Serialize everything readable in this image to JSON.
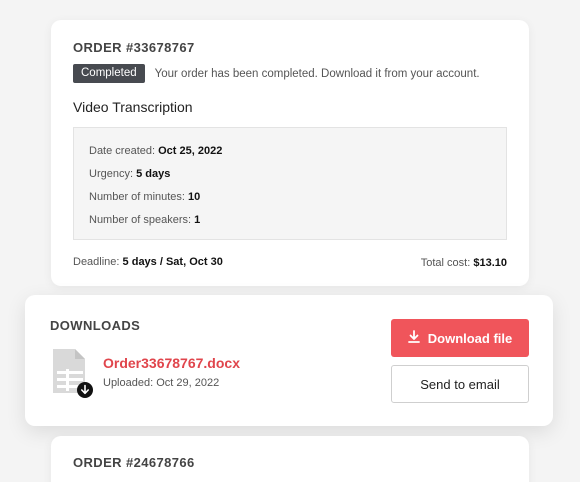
{
  "order": {
    "id": "ORDER #33678767",
    "status_badge": "Completed",
    "status_text": "Your order has been completed. Download it from your account.",
    "service": "Video Transcription",
    "details": {
      "date_created_label": "Date created:",
      "date_created_value": "Oct 25, 2022",
      "urgency_label": "Urgency:",
      "urgency_value": "5 days",
      "minutes_label": "Number of minutes:",
      "minutes_value": "10",
      "speakers_label": "Number of speakers:",
      "speakers_value": "1"
    },
    "deadline_label": "Deadline:",
    "deadline_value": "5 days / Sat, Oct 30",
    "total_label": "Total cost:",
    "total_value": "$13.10"
  },
  "downloads": {
    "title": "DOWNLOADS",
    "file_name": "Order33678767.docx",
    "uploaded": "Uploaded: Oct 29, 2022",
    "file_icon": "document-icon",
    "download_button": "Download file",
    "download_icon": "download-arrow-icon",
    "email_button": "Send to email"
  },
  "next_order": {
    "id": "ORDER #24678766"
  },
  "colors": {
    "accent": "#f0555b",
    "file_link": "#e0454c",
    "badge_bg": "#474a50"
  }
}
